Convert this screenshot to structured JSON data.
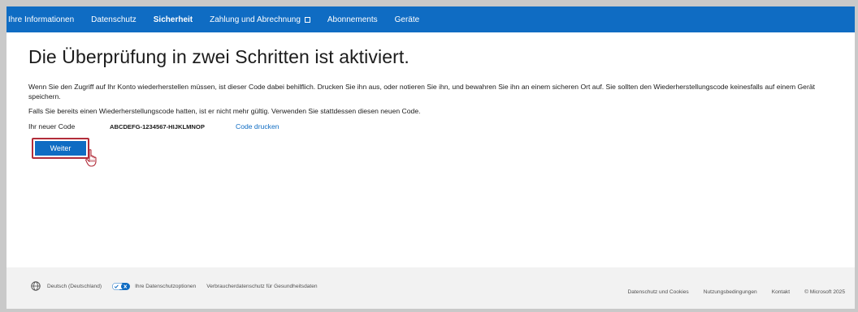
{
  "nav": {
    "items": [
      {
        "label": "Ihre Informationen",
        "active": false
      },
      {
        "label": "Datenschutz",
        "active": false
      },
      {
        "label": "Sicherheit",
        "active": true
      },
      {
        "label": "Zahlung und Abrechnung",
        "active": false,
        "icon": "external-link-icon"
      },
      {
        "label": "Abonnements",
        "active": false
      },
      {
        "label": "Geräte",
        "active": false
      }
    ],
    "background": "#0f6cc3"
  },
  "main": {
    "title": "Die Überprüfung in zwei Schritten ist aktiviert.",
    "para1": "Wenn Sie den Zugriff auf Ihr Konto wiederherstellen müssen, ist dieser Code dabei behilflich. Drucken Sie ihn aus, oder notieren Sie ihn, und bewahren Sie ihn an einem sicheren Ort auf. Sie sollten den Wiederherstellungscode keinesfalls auf einem Gerät speichern.",
    "para2": "Falls Sie bereits einen Wiederherstellungscode hatten, ist er nicht mehr gültig. Verwenden Sie stattdessen diesen neuen Code.",
    "code_label": "Ihr neuer Code",
    "code_value": "ABCDEFG-1234567-HIJKLMNOP",
    "print_link": "Code drucken",
    "continue_button": "Weiter",
    "highlight_color": "#b22d3a"
  },
  "footer": {
    "language": "Deutsch (Deutschland)",
    "privacy_options": "Ihre Datenschutzoptionen",
    "health_privacy": "Verbraucherdatenschutz für Gesundheitsdaten",
    "links": [
      "Datenschutz und Cookies",
      "Nutzungsbedingungen",
      "Kontakt",
      "© Microsoft 2025"
    ]
  }
}
